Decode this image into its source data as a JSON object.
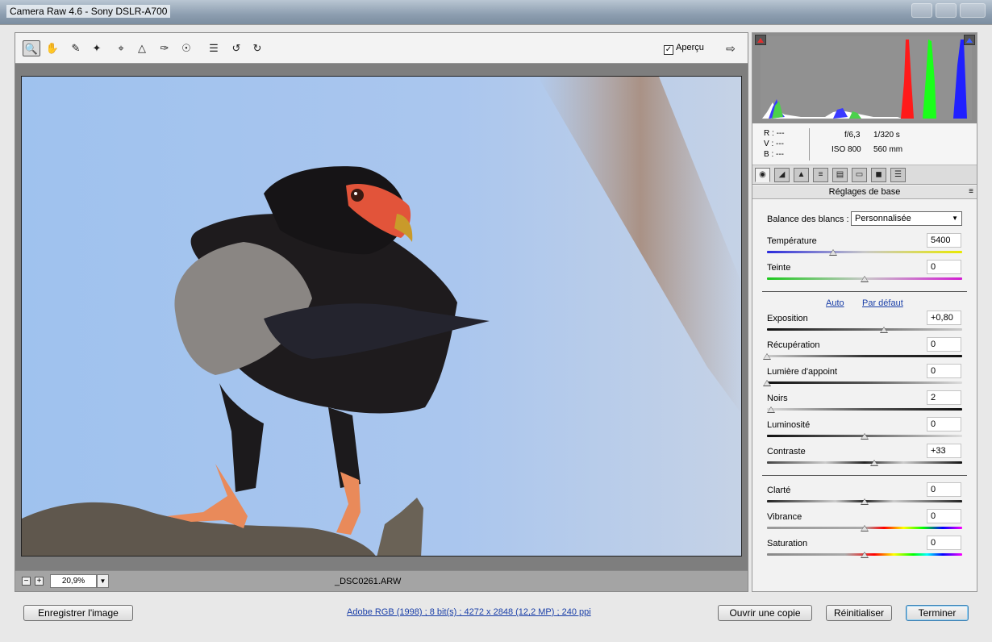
{
  "window": {
    "title": "Camera Raw 4.6  -  Sony DSLR-A700"
  },
  "toolbar": {
    "tools": [
      "zoom-icon",
      "hand-icon",
      "white-balance-icon",
      "color-sampler-icon",
      "crop-icon",
      "straighten-icon",
      "retouch-icon",
      "red-eye-icon",
      "preferences-icon",
      "rotate-left-icon",
      "rotate-right-icon"
    ],
    "preview_label": "Aperçu",
    "preview_checked": true
  },
  "status": {
    "zoom": "20,9%",
    "filename": "_DSC0261.ARW"
  },
  "info": {
    "r_label": "R :",
    "v_label": "V :",
    "b_label": "B :",
    "r_value": "---",
    "v_value": "---",
    "b_value": "---",
    "aperture": "f/6,3",
    "shutter": "1/320 s",
    "iso": "ISO 800",
    "focal": "560 mm"
  },
  "panel": {
    "title": "Réglages de base",
    "wb_label": "Balance des blancs :",
    "wb_value": "Personnalisée",
    "auto": "Auto",
    "default": "Par défaut",
    "sliders": [
      {
        "label": "Température",
        "value": "5400",
        "pos": 0.34
      },
      {
        "label": "Teinte",
        "value": "0",
        "pos": 0.5
      },
      {
        "label": "Exposition",
        "value": "+0,80",
        "pos": 0.6
      },
      {
        "label": "Récupération",
        "value": "0",
        "pos": 0.0
      },
      {
        "label": "Lumière d'appoint",
        "value": "0",
        "pos": 0.0
      },
      {
        "label": "Noirs",
        "value": "2",
        "pos": 0.02
      },
      {
        "label": "Luminosité",
        "value": "0",
        "pos": 0.5
      },
      {
        "label": "Contraste",
        "value": "+33",
        "pos": 0.55
      },
      {
        "label": "Clarté",
        "value": "0",
        "pos": 0.5
      },
      {
        "label": "Vibrance",
        "value": "0",
        "pos": 0.5
      },
      {
        "label": "Saturation",
        "value": "0",
        "pos": 0.5
      }
    ]
  },
  "footer": {
    "save": "Enregistrer l'image",
    "workflow": "Adobe RGB (1998) ; 8 bit(s) ; 4272 x 2848 (12,2 MP) ; 240 ppi",
    "open_copy": "Ouvrir une copie",
    "reset": "Réinitialiser",
    "done": "Terminer"
  }
}
